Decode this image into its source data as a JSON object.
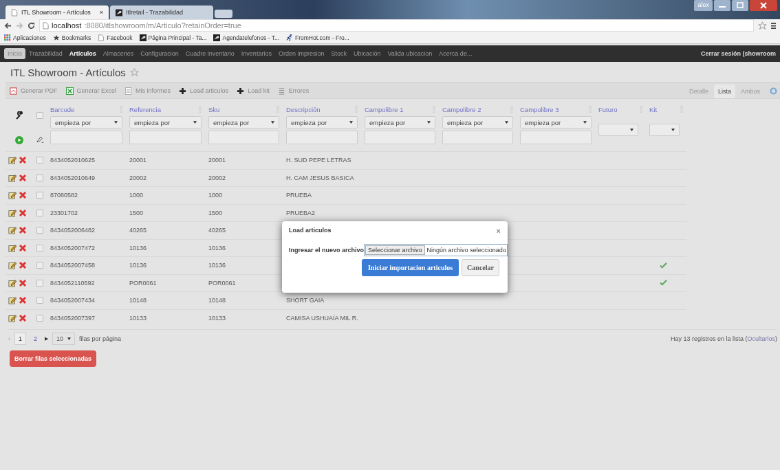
{
  "browser": {
    "tabs": [
      {
        "title": "ITL Showroom - Artículos",
        "selected": true,
        "close": "×"
      },
      {
        "title": "Itlretail - Trazabilidad",
        "selected": false
      }
    ],
    "user": "alex",
    "address": {
      "host": "localhost",
      "rest": ":8080/itlshowroom/m/Articulo?retainOrder=true"
    },
    "bookmarks": [
      {
        "label": "Aplicaciones",
        "kind": "apps"
      },
      {
        "label": "Bookmarks",
        "kind": "star"
      },
      {
        "label": "Facebook",
        "kind": "page"
      },
      {
        "label": "Página Principal - Ta...",
        "kind": "site"
      },
      {
        "label": "Agendatelefonos - T...",
        "kind": "site"
      },
      {
        "label": "FromHot.com - Fro...",
        "kind": "runner"
      }
    ]
  },
  "nav": {
    "items": [
      {
        "label": "Inicio",
        "selected": false,
        "hovered": true
      },
      {
        "label": "Trazabilidad",
        "selected": false,
        "hovered": false
      },
      {
        "label": "Artículos",
        "selected": true,
        "hovered": false
      },
      {
        "label": "Almacenes",
        "selected": false,
        "hovered": false
      },
      {
        "label": "Configuracion",
        "selected": false,
        "hovered": false
      },
      {
        "label": "Cuadre inventario",
        "selected": false,
        "hovered": false
      },
      {
        "label": "Inventarios",
        "selected": false,
        "hovered": false
      },
      {
        "label": "Orden impresion",
        "selected": false,
        "hovered": false
      },
      {
        "label": "Stock",
        "selected": false,
        "hovered": false
      },
      {
        "label": "Ubicación",
        "selected": false,
        "hovered": false
      },
      {
        "label": "Valida ubicacion",
        "selected": false,
        "hovered": false
      },
      {
        "label": "Acerca de...",
        "selected": false,
        "hovered": false
      }
    ],
    "logout": "Cerrar sesión (showroom"
  },
  "page_title": "ITL Showroom - Artículos",
  "toolbar": [
    {
      "label": "Generar PDF",
      "kind": "pdf"
    },
    {
      "label": "Generar Excel",
      "kind": "excel"
    },
    {
      "label": "Mis informes",
      "kind": "report"
    },
    {
      "label": "Load articulos",
      "kind": "plus"
    },
    {
      "label": "Load kit",
      "kind": "plus"
    },
    {
      "label": "Errores",
      "kind": "list"
    }
  ],
  "view_tabs": [
    {
      "label": "Detalle",
      "selected": false
    },
    {
      "label": "Lista",
      "selected": true
    },
    {
      "label": "Ambos",
      "selected": false
    }
  ],
  "table": {
    "select_all_checked": false,
    "columns": [
      {
        "label": "Barcode",
        "filter": "empieza por"
      },
      {
        "label": "Referencia",
        "filter": "empieza por"
      },
      {
        "label": "Sku",
        "filter": "empieza por"
      },
      {
        "label": "Descripción",
        "filter": "empieza por"
      },
      {
        "label": "Campolibre 1",
        "filter": "empieza por"
      },
      {
        "label": "Campolibre 2",
        "filter": "empieza por"
      },
      {
        "label": "Campolibre 3",
        "filter": "empieza por"
      },
      {
        "label": "Futuro"
      },
      {
        "label": "Kit"
      }
    ],
    "rows": [
      {
        "barcode": "8434052010625",
        "referencia": "20001",
        "sku": "20001",
        "descripcion": "H. SUD PEPE LETRAS",
        "checked": false,
        "kit": false
      },
      {
        "barcode": "8434052010649",
        "referencia": "20002",
        "sku": "20002",
        "descripcion": "H. CAM JESUS BASICA",
        "checked": false,
        "kit": false
      },
      {
        "barcode": "87080582",
        "referencia": "1000",
        "sku": "1000",
        "descripcion": "PRUEBA",
        "checked": false,
        "kit": false
      },
      {
        "barcode": "23301702",
        "referencia": "1500",
        "sku": "1500",
        "descripcion": "PRUEBA2",
        "checked": false,
        "kit": false
      },
      {
        "barcode": "8434052006482",
        "referencia": "40265",
        "sku": "40265",
        "checked": false,
        "kit": false
      },
      {
        "barcode": "8434052007472",
        "referencia": "10136",
        "sku": "10136",
        "checked": false,
        "kit": false
      },
      {
        "barcode": "8434052007458",
        "referencia": "10136",
        "sku": "10136",
        "checked": false,
        "kit": true
      },
      {
        "barcode": "8434052110592",
        "referencia": "POR0061",
        "sku": "POR0061",
        "checked": false,
        "kit": true
      },
      {
        "barcode": "8434052007434",
        "referencia": "10148",
        "sku": "10148",
        "descripcion": "SHORT GAIA",
        "checked": false,
        "kit": false
      },
      {
        "barcode": "8434052007397",
        "referencia": "10133",
        "sku": "10133",
        "descripcion": "CAMISA USHUAÍA MIL R.",
        "checked": false,
        "kit": false
      }
    ]
  },
  "pagination": {
    "prev": "‹",
    "pages": [
      {
        "label": "1",
        "selected": true
      },
      {
        "label": "2",
        "selected": false
      }
    ],
    "next": "▶",
    "page_size": "10",
    "page_size_label": "filas por página"
  },
  "summary": {
    "text": "Hay 13 registros en la lista (",
    "link": "Ocultarlos",
    "end": ")"
  },
  "delete_button": "Borrar filas seleccionadas",
  "modal": {
    "title": "Load articulos",
    "close": "×",
    "label": "Ingresar el nuevo archivo",
    "file_button": "Seleccionar archivo",
    "file_status": "Ningún archivo seleccionado",
    "primary": "Iniciar importacion articulos",
    "cancel": "Cancelar"
  }
}
